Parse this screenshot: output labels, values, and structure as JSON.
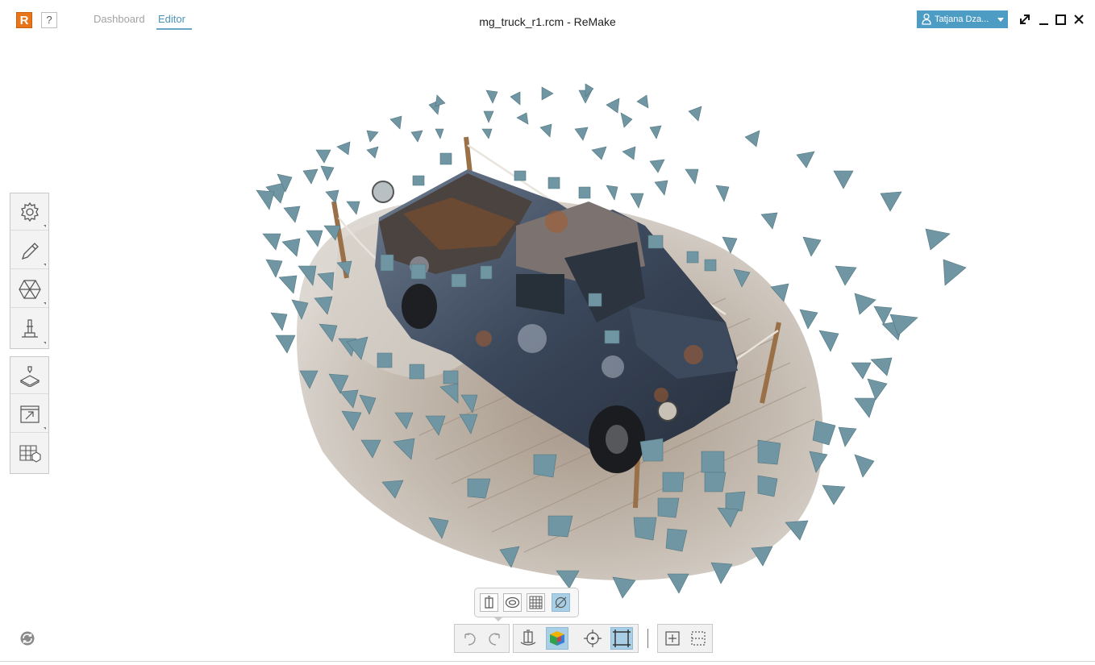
{
  "app": {
    "logo_letter": "R",
    "help_label": "?",
    "window_title": "mg_truck_r1.rcm - ReMake",
    "accent_color": "#4c9cc4",
    "brand_color": "#e8751a"
  },
  "tabs": [
    {
      "label": "Dashboard",
      "active": false
    },
    {
      "label": "Editor",
      "active": true
    }
  ],
  "user": {
    "name": "Tatjana Dza..."
  },
  "window_controls": [
    "expand-icon",
    "minimize-icon",
    "maximize-icon",
    "close-icon"
  ],
  "sidebar": {
    "group1": [
      "settings-gear-icon",
      "pencil-edit-icon",
      "hexagon-mesh-icon",
      "microscope-analyze-icon"
    ],
    "group2": [
      "3d-print-icon",
      "export-icon",
      "table-cube-icon"
    ]
  },
  "viewport": {
    "content": "3d-model-truck",
    "camera_color": "#6f96a2"
  },
  "view_mode_popup": {
    "items": [
      "solid-box-icon",
      "ring-object-icon",
      "grid-texture-icon",
      "no-texture-icon"
    ],
    "active_index": 3
  },
  "toolbar": {
    "items": [
      "undo-icon",
      "redo-icon",
      "object-view-icon",
      "color-cube-icon",
      "focus-target-icon",
      "bounding-frame-icon",
      "fit-view-icon",
      "select-region-icon"
    ]
  }
}
